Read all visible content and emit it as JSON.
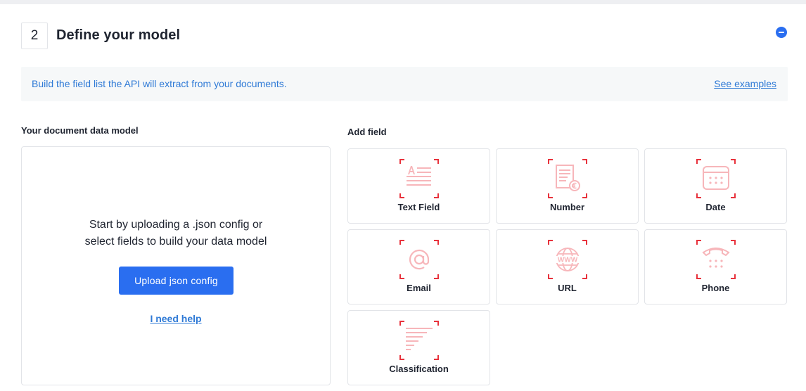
{
  "step": {
    "number": "2",
    "title": "Define your model"
  },
  "banner": {
    "text": "Build the field list the API will extract from your documents.",
    "link": "See examples"
  },
  "model": {
    "heading": "Your document data model",
    "message_line1": "Start by uploading a .json config or",
    "message_line2": "select fields to build your data model",
    "upload_label": "Upload json config",
    "help_label": "I need help"
  },
  "add_field": {
    "heading": "Add field",
    "fields": [
      {
        "label": "Text Field",
        "icon": "text-field-icon"
      },
      {
        "label": "Number",
        "icon": "number-icon"
      },
      {
        "label": "Date",
        "icon": "date-icon"
      },
      {
        "label": "Email",
        "icon": "email-icon"
      },
      {
        "label": "URL",
        "icon": "url-icon"
      },
      {
        "label": "Phone",
        "icon": "phone-icon"
      },
      {
        "label": "Classification",
        "icon": "classification-icon"
      }
    ]
  },
  "colors": {
    "accent": "#2a6ef0",
    "link": "#2f7ad6",
    "icon_corner": "#e8323c",
    "icon_fill": "#f7b6ba"
  }
}
